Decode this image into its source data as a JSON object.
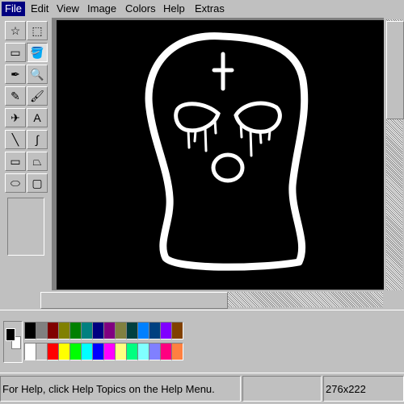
{
  "menu": [
    {
      "key": "file",
      "label": "File",
      "active": true
    },
    {
      "key": "edit",
      "label": "Edit",
      "active": false
    },
    {
      "key": "view",
      "label": "View",
      "active": false
    },
    {
      "key": "image",
      "label": "Image",
      "active": false
    },
    {
      "key": "colors",
      "label": "Colors",
      "active": false
    },
    {
      "key": "help",
      "label": "Help",
      "active": false
    },
    {
      "key": "extras",
      "label": "Extras",
      "active": false
    }
  ],
  "tools": [
    {
      "name": "free-form-select-icon",
      "glyph": "☆"
    },
    {
      "name": "rect-select-icon",
      "glyph": "⬚"
    },
    {
      "name": "eraser-icon",
      "glyph": "▭"
    },
    {
      "name": "fill-bucket-icon",
      "glyph": "🪣",
      "pressed": true
    },
    {
      "name": "color-picker-icon",
      "glyph": "✒"
    },
    {
      "name": "magnifier-icon",
      "glyph": "🔍"
    },
    {
      "name": "pencil-icon",
      "glyph": "✎"
    },
    {
      "name": "brush-icon",
      "glyph": "🖌"
    },
    {
      "name": "airbrush-icon",
      "glyph": "✈"
    },
    {
      "name": "text-icon",
      "glyph": "A"
    },
    {
      "name": "line-icon",
      "glyph": "╲"
    },
    {
      "name": "curve-icon",
      "glyph": "∫"
    },
    {
      "name": "rectangle-icon",
      "glyph": "▭"
    },
    {
      "name": "polygon-icon",
      "glyph": "⏢"
    },
    {
      "name": "ellipse-icon",
      "glyph": "⬭"
    },
    {
      "name": "rounded-rect-icon",
      "glyph": "▢"
    }
  ],
  "palette": {
    "top": [
      "#000000",
      "#808080",
      "#800000",
      "#808000",
      "#008000",
      "#008080",
      "#000080",
      "#800080",
      "#808040",
      "#004040",
      "#0080ff",
      "#004080",
      "#8000ff",
      "#804000"
    ],
    "bottom": [
      "#ffffff",
      "#c0c0c0",
      "#ff0000",
      "#ffff00",
      "#00ff00",
      "#00ffff",
      "#0000ff",
      "#ff00ff",
      "#ffff80",
      "#00ff80",
      "#80ffff",
      "#8080ff",
      "#ff0080",
      "#ff8040"
    ]
  },
  "foreground_color": "#000000",
  "background_color": "#ffffff",
  "status": {
    "help_text": "For Help, click Help Topics on the Help Menu.",
    "size": "276x222"
  },
  "accent": "#000080"
}
